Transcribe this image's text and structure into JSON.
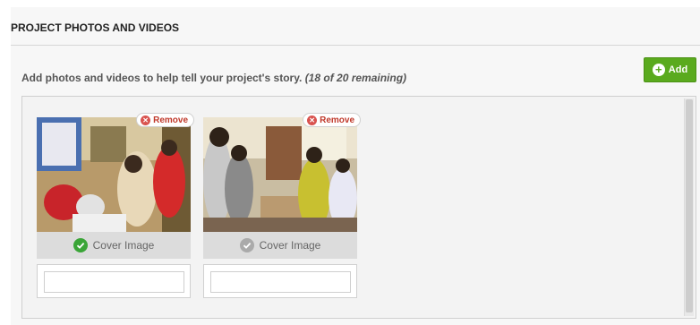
{
  "section": {
    "title": "PROJECT PHOTOS AND VIDEOS",
    "helper_text": "Add photos and videos to help tell your project's story.",
    "remaining_text": "(18 of 20 remaining)",
    "add_label": "Add"
  },
  "media": [
    {
      "remove_label": "Remove",
      "cover_label": "Cover Image",
      "is_cover": true,
      "caption": ""
    },
    {
      "remove_label": "Remove",
      "cover_label": "Cover Image",
      "is_cover": false,
      "caption": ""
    }
  ],
  "icons": {
    "add": "plus-circle-icon",
    "remove": "x-circle-icon",
    "cover": "check-circle-icon"
  },
  "colors": {
    "add_button": "#5aaa1e",
    "cover_active": "#3aa537",
    "cover_inactive": "#aaaaaa",
    "remove_icon": "#d9534f"
  }
}
